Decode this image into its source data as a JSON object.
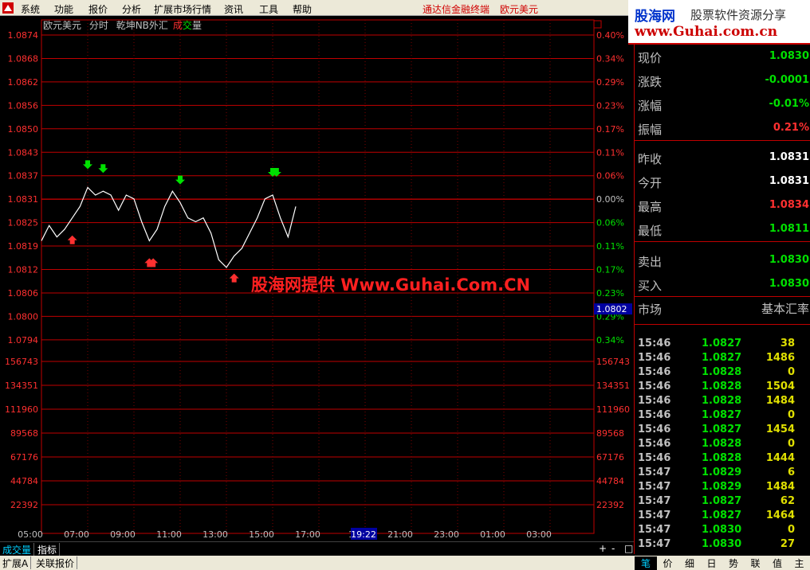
{
  "menu": {
    "items": [
      "系统",
      "功能",
      "报价",
      "分析",
      "扩展市场行情",
      "资讯",
      "工具",
      "帮助"
    ],
    "app_title": "通达信金融终端",
    "instrument": "欧元美元"
  },
  "banner": {
    "site_name": "股海网",
    "slogan": "股票软件资源分享",
    "url": "www.Guhai.com.cn"
  },
  "chart_header": {
    "name": "欧元美元",
    "mode": "分时",
    "indicator": "乾坤NB外汇",
    "volume_label_1": "成",
    "volume_label_2": "交",
    "volume_label_3": "量"
  },
  "watermark": "股海网提供 Www.Guhai.Com.CN",
  "colors": {
    "red": "#c00000",
    "up": "#ff3030",
    "down": "#00e000",
    "neutral": "#c0c0c0",
    "yellow": "#e0e000"
  },
  "chart_data": {
    "type": "line",
    "price_ticks_left": [
      "1.0874",
      "1.0868",
      "1.0862",
      "1.0856",
      "1.0850",
      "1.0843",
      "1.0837",
      "1.0831",
      "1.0825",
      "1.0819",
      "1.0812",
      "1.0806",
      "1.0800",
      "1.0794"
    ],
    "pct_ticks_right": [
      "0.40%",
      "0.34%",
      "0.29%",
      "0.23%",
      "0.17%",
      "0.11%",
      "0.06%",
      "0.00%",
      "0.06%",
      "0.11%",
      "0.17%",
      "0.23%",
      "0.29%",
      "0.34%"
    ],
    "volume_ticks": [
      "156743",
      "134351",
      "111960",
      "89568",
      "67176",
      "44784",
      "22392"
    ],
    "time_ticks": [
      "05:00",
      "07:00",
      "09:00",
      "11:00",
      "13:00",
      "15:00",
      "17:00",
      "19",
      "21:00",
      "23:00",
      "01:00",
      "03:00"
    ],
    "cursor_price": "1.0802",
    "cursor_time": "19:22",
    "prev_close": 1.0831,
    "x": [
      "05:00",
      "05:20",
      "05:40",
      "06:00",
      "06:20",
      "06:40",
      "07:00",
      "07:20",
      "07:40",
      "08:00",
      "08:20",
      "08:40",
      "09:00",
      "09:20",
      "09:40",
      "10:00",
      "10:20",
      "10:40",
      "11:00",
      "11:20",
      "11:40",
      "12:00",
      "12:20",
      "12:40",
      "13:00",
      "13:20",
      "13:40",
      "14:00",
      "14:20",
      "14:40",
      "15:00",
      "15:20",
      "15:40",
      "16:00"
    ],
    "y": [
      1.082,
      1.0824,
      1.0821,
      1.0823,
      1.0826,
      1.0829,
      1.0834,
      1.0832,
      1.0833,
      1.0832,
      1.0828,
      1.0832,
      1.0831,
      1.0825,
      1.082,
      1.0823,
      1.0829,
      1.0833,
      1.083,
      1.0826,
      1.0825,
      1.0826,
      1.0822,
      1.0815,
      1.0813,
      1.0816,
      1.0818,
      1.0822,
      1.0826,
      1.0831,
      1.0832,
      1.0826,
      1.0821,
      1.0829
    ],
    "y_range": [
      1.079,
      1.0877
    ],
    "buy_signal_times": [
      "06:20",
      "09:40",
      "09:50",
      "13:20"
    ],
    "sell_signal_times": [
      "07:00",
      "07:40",
      "11:00",
      "15:00",
      "15:10"
    ]
  },
  "quote": {
    "rows": [
      {
        "label": "现价",
        "value": "1.0830",
        "color": "#00e000"
      },
      {
        "label": "涨跌",
        "value": "-0.0001",
        "color": "#00e000"
      },
      {
        "label": "涨幅",
        "value": "-0.01%",
        "color": "#00e000"
      },
      {
        "label": "振幅",
        "value": "0.21%",
        "color": "#ff3030"
      },
      {
        "label": "昨收",
        "value": "1.0831",
        "color": "#ffffff"
      },
      {
        "label": "今开",
        "value": "1.0831",
        "color": "#ffffff"
      },
      {
        "label": "最高",
        "value": "1.0834",
        "color": "#ff3030"
      },
      {
        "label": "最低",
        "value": "1.0811",
        "color": "#00e000"
      },
      {
        "label": "卖出",
        "value": "1.0830",
        "color": "#00e000"
      },
      {
        "label": "买入",
        "value": "1.0830",
        "color": "#00e000"
      }
    ],
    "market_label": "市场",
    "market_value": "基本汇率"
  },
  "ticks": [
    {
      "time": "15:46",
      "price": "1.0827",
      "vol": "38"
    },
    {
      "time": "15:46",
      "price": "1.0827",
      "vol": "1486"
    },
    {
      "time": "15:46",
      "price": "1.0828",
      "vol": "0"
    },
    {
      "time": "15:46",
      "price": "1.0828",
      "vol": "1504"
    },
    {
      "time": "15:46",
      "price": "1.0828",
      "vol": "1484"
    },
    {
      "time": "15:46",
      "price": "1.0827",
      "vol": "0"
    },
    {
      "time": "15:46",
      "price": "1.0827",
      "vol": "1454"
    },
    {
      "time": "15:46",
      "price": "1.0828",
      "vol": "0"
    },
    {
      "time": "15:46",
      "price": "1.0828",
      "vol": "1444"
    },
    {
      "time": "15:47",
      "price": "1.0829",
      "vol": "6"
    },
    {
      "time": "15:47",
      "price": "1.0829",
      "vol": "1484"
    },
    {
      "time": "15:47",
      "price": "1.0827",
      "vol": "62"
    },
    {
      "time": "15:47",
      "price": "1.0827",
      "vol": "1464"
    },
    {
      "time": "15:47",
      "price": "1.0830",
      "vol": "0"
    },
    {
      "time": "15:47",
      "price": "1.0830",
      "vol": "27"
    }
  ],
  "bottom_tabs": {
    "volume": "成交量",
    "indicator": "指标",
    "plus": "+",
    "minus": "-",
    "close": "□"
  },
  "status_tabs": {
    "ext": "扩展A",
    "linked": "关联报价"
  },
  "right_tabs": [
    "笔",
    "价",
    "细",
    "日",
    "势",
    "联",
    "值",
    "主"
  ]
}
